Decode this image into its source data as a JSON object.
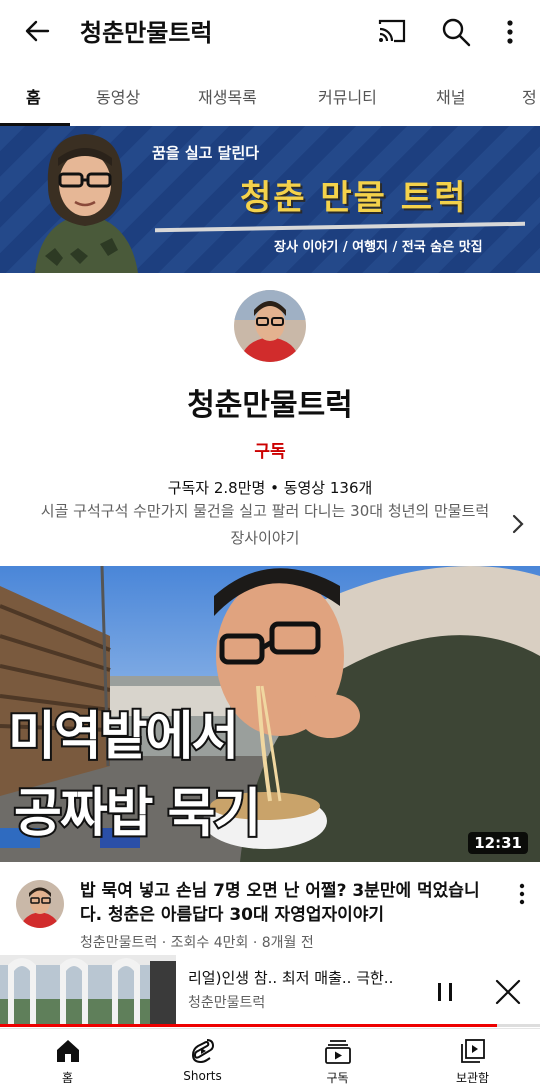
{
  "header": {
    "title": "청춘만물트럭",
    "icons": [
      "back-arrow-icon",
      "cast-icon",
      "search-icon",
      "more-vert-icon"
    ]
  },
  "tabs": [
    {
      "label": "홈",
      "active": true
    },
    {
      "label": "동영상",
      "active": false
    },
    {
      "label": "재생목록",
      "active": false
    },
    {
      "label": "커뮤니티",
      "active": false
    },
    {
      "label": "채널",
      "active": false
    },
    {
      "label": "정",
      "active": false
    }
  ],
  "banner": {
    "tagline": "꿈을 실고 달린다",
    "headline": "청춘 만물 트럭",
    "subline": "장사 이야기 / 여행지 / 전국 숨은 맛집"
  },
  "channel": {
    "name": "청춘만물트럭",
    "subscribe_label": "구독",
    "stats": "구독자 2.8만명 • 동영상 136개",
    "description": "시골 구석구석 수만가지 물건을 실고 팔러 다니는 30대 청년의 만물트럭 장사이야기"
  },
  "video": {
    "thumb_caption_line1": "미역밭에서",
    "thumb_caption_line2": "공짜밥 묵기",
    "duration": "12:31",
    "title": "밥 묵여 넣고 손님 7명 오면 난 어쩔? 3분만에 먹었습니다. 청춘은 아름답다 30대 자영업자이야기",
    "meta": "청춘만물트럭 · 조회수 4만회 · 8개월 전"
  },
  "miniplayer": {
    "title": "리얼)인생 참.. 최저 매출.. 극한..",
    "channel": "청춘만물트럭",
    "progress": 0.92
  },
  "bottom_nav": [
    {
      "label": "홈",
      "icon": "home-icon"
    },
    {
      "label": "Shorts",
      "icon": "shorts-icon"
    },
    {
      "label": "구독",
      "icon": "subscriptions-icon"
    },
    {
      "label": "보관함",
      "icon": "library-icon"
    }
  ],
  "colors": {
    "accent_red": "#cc0000",
    "progress_red": "#ee0000",
    "banner_blue": "#1d3f7f",
    "banner_yellow": "#f4d24b"
  }
}
